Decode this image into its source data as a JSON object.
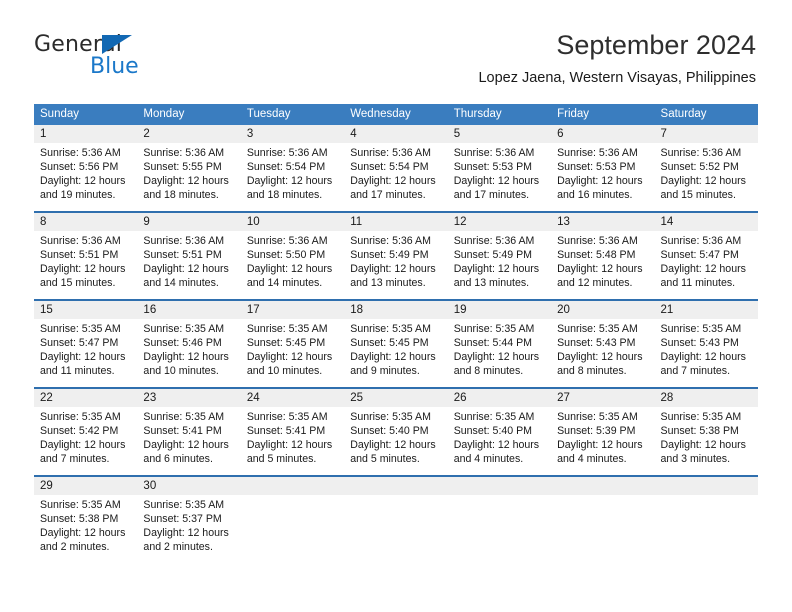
{
  "brand": {
    "name_top": "General",
    "name_bottom": "Blue",
    "accent_color": "#1268b3"
  },
  "header": {
    "title": "September 2024",
    "subtitle": "Lopez Jaena, Western Visayas, Philippines"
  },
  "theme": {
    "header_bar_color": "#3a7dbf",
    "row_divider_color": "#2f6fae",
    "daynum_band_color": "#efefef",
    "text_color": "#1a1a1a"
  },
  "weekdays": [
    "Sunday",
    "Monday",
    "Tuesday",
    "Wednesday",
    "Thursday",
    "Friday",
    "Saturday"
  ],
  "weeks": [
    [
      {
        "day": "1",
        "sunrise": "Sunrise: 5:36 AM",
        "sunset": "Sunset: 5:56 PM",
        "daylight1": "Daylight: 12 hours",
        "daylight2": "and 19 minutes."
      },
      {
        "day": "2",
        "sunrise": "Sunrise: 5:36 AM",
        "sunset": "Sunset: 5:55 PM",
        "daylight1": "Daylight: 12 hours",
        "daylight2": "and 18 minutes."
      },
      {
        "day": "3",
        "sunrise": "Sunrise: 5:36 AM",
        "sunset": "Sunset: 5:54 PM",
        "daylight1": "Daylight: 12 hours",
        "daylight2": "and 18 minutes."
      },
      {
        "day": "4",
        "sunrise": "Sunrise: 5:36 AM",
        "sunset": "Sunset: 5:54 PM",
        "daylight1": "Daylight: 12 hours",
        "daylight2": "and 17 minutes."
      },
      {
        "day": "5",
        "sunrise": "Sunrise: 5:36 AM",
        "sunset": "Sunset: 5:53 PM",
        "daylight1": "Daylight: 12 hours",
        "daylight2": "and 17 minutes."
      },
      {
        "day": "6",
        "sunrise": "Sunrise: 5:36 AM",
        "sunset": "Sunset: 5:53 PM",
        "daylight1": "Daylight: 12 hours",
        "daylight2": "and 16 minutes."
      },
      {
        "day": "7",
        "sunrise": "Sunrise: 5:36 AM",
        "sunset": "Sunset: 5:52 PM",
        "daylight1": "Daylight: 12 hours",
        "daylight2": "and 15 minutes."
      }
    ],
    [
      {
        "day": "8",
        "sunrise": "Sunrise: 5:36 AM",
        "sunset": "Sunset: 5:51 PM",
        "daylight1": "Daylight: 12 hours",
        "daylight2": "and 15 minutes."
      },
      {
        "day": "9",
        "sunrise": "Sunrise: 5:36 AM",
        "sunset": "Sunset: 5:51 PM",
        "daylight1": "Daylight: 12 hours",
        "daylight2": "and 14 minutes."
      },
      {
        "day": "10",
        "sunrise": "Sunrise: 5:36 AM",
        "sunset": "Sunset: 5:50 PM",
        "daylight1": "Daylight: 12 hours",
        "daylight2": "and 14 minutes."
      },
      {
        "day": "11",
        "sunrise": "Sunrise: 5:36 AM",
        "sunset": "Sunset: 5:49 PM",
        "daylight1": "Daylight: 12 hours",
        "daylight2": "and 13 minutes."
      },
      {
        "day": "12",
        "sunrise": "Sunrise: 5:36 AM",
        "sunset": "Sunset: 5:49 PM",
        "daylight1": "Daylight: 12 hours",
        "daylight2": "and 13 minutes."
      },
      {
        "day": "13",
        "sunrise": "Sunrise: 5:36 AM",
        "sunset": "Sunset: 5:48 PM",
        "daylight1": "Daylight: 12 hours",
        "daylight2": "and 12 minutes."
      },
      {
        "day": "14",
        "sunrise": "Sunrise: 5:36 AM",
        "sunset": "Sunset: 5:47 PM",
        "daylight1": "Daylight: 12 hours",
        "daylight2": "and 11 minutes."
      }
    ],
    [
      {
        "day": "15",
        "sunrise": "Sunrise: 5:35 AM",
        "sunset": "Sunset: 5:47 PM",
        "daylight1": "Daylight: 12 hours",
        "daylight2": "and 11 minutes."
      },
      {
        "day": "16",
        "sunrise": "Sunrise: 5:35 AM",
        "sunset": "Sunset: 5:46 PM",
        "daylight1": "Daylight: 12 hours",
        "daylight2": "and 10 minutes."
      },
      {
        "day": "17",
        "sunrise": "Sunrise: 5:35 AM",
        "sunset": "Sunset: 5:45 PM",
        "daylight1": "Daylight: 12 hours",
        "daylight2": "and 10 minutes."
      },
      {
        "day": "18",
        "sunrise": "Sunrise: 5:35 AM",
        "sunset": "Sunset: 5:45 PM",
        "daylight1": "Daylight: 12 hours",
        "daylight2": "and 9 minutes."
      },
      {
        "day": "19",
        "sunrise": "Sunrise: 5:35 AM",
        "sunset": "Sunset: 5:44 PM",
        "daylight1": "Daylight: 12 hours",
        "daylight2": "and 8 minutes."
      },
      {
        "day": "20",
        "sunrise": "Sunrise: 5:35 AM",
        "sunset": "Sunset: 5:43 PM",
        "daylight1": "Daylight: 12 hours",
        "daylight2": "and 8 minutes."
      },
      {
        "day": "21",
        "sunrise": "Sunrise: 5:35 AM",
        "sunset": "Sunset: 5:43 PM",
        "daylight1": "Daylight: 12 hours",
        "daylight2": "and 7 minutes."
      }
    ],
    [
      {
        "day": "22",
        "sunrise": "Sunrise: 5:35 AM",
        "sunset": "Sunset: 5:42 PM",
        "daylight1": "Daylight: 12 hours",
        "daylight2": "and 7 minutes."
      },
      {
        "day": "23",
        "sunrise": "Sunrise: 5:35 AM",
        "sunset": "Sunset: 5:41 PM",
        "daylight1": "Daylight: 12 hours",
        "daylight2": "and 6 minutes."
      },
      {
        "day": "24",
        "sunrise": "Sunrise: 5:35 AM",
        "sunset": "Sunset: 5:41 PM",
        "daylight1": "Daylight: 12 hours",
        "daylight2": "and 5 minutes."
      },
      {
        "day": "25",
        "sunrise": "Sunrise: 5:35 AM",
        "sunset": "Sunset: 5:40 PM",
        "daylight1": "Daylight: 12 hours",
        "daylight2": "and 5 minutes."
      },
      {
        "day": "26",
        "sunrise": "Sunrise: 5:35 AM",
        "sunset": "Sunset: 5:40 PM",
        "daylight1": "Daylight: 12 hours",
        "daylight2": "and 4 minutes."
      },
      {
        "day": "27",
        "sunrise": "Sunrise: 5:35 AM",
        "sunset": "Sunset: 5:39 PM",
        "daylight1": "Daylight: 12 hours",
        "daylight2": "and 4 minutes."
      },
      {
        "day": "28",
        "sunrise": "Sunrise: 5:35 AM",
        "sunset": "Sunset: 5:38 PM",
        "daylight1": "Daylight: 12 hours",
        "daylight2": "and 3 minutes."
      }
    ],
    [
      {
        "day": "29",
        "sunrise": "Sunrise: 5:35 AM",
        "sunset": "Sunset: 5:38 PM",
        "daylight1": "Daylight: 12 hours",
        "daylight2": "and 2 minutes."
      },
      {
        "day": "30",
        "sunrise": "Sunrise: 5:35 AM",
        "sunset": "Sunset: 5:37 PM",
        "daylight1": "Daylight: 12 hours",
        "daylight2": "and 2 minutes."
      },
      {
        "day": "",
        "sunrise": "",
        "sunset": "",
        "daylight1": "",
        "daylight2": ""
      },
      {
        "day": "",
        "sunrise": "",
        "sunset": "",
        "daylight1": "",
        "daylight2": ""
      },
      {
        "day": "",
        "sunrise": "",
        "sunset": "",
        "daylight1": "",
        "daylight2": ""
      },
      {
        "day": "",
        "sunrise": "",
        "sunset": "",
        "daylight1": "",
        "daylight2": ""
      },
      {
        "day": "",
        "sunrise": "",
        "sunset": "",
        "daylight1": "",
        "daylight2": ""
      }
    ]
  ]
}
